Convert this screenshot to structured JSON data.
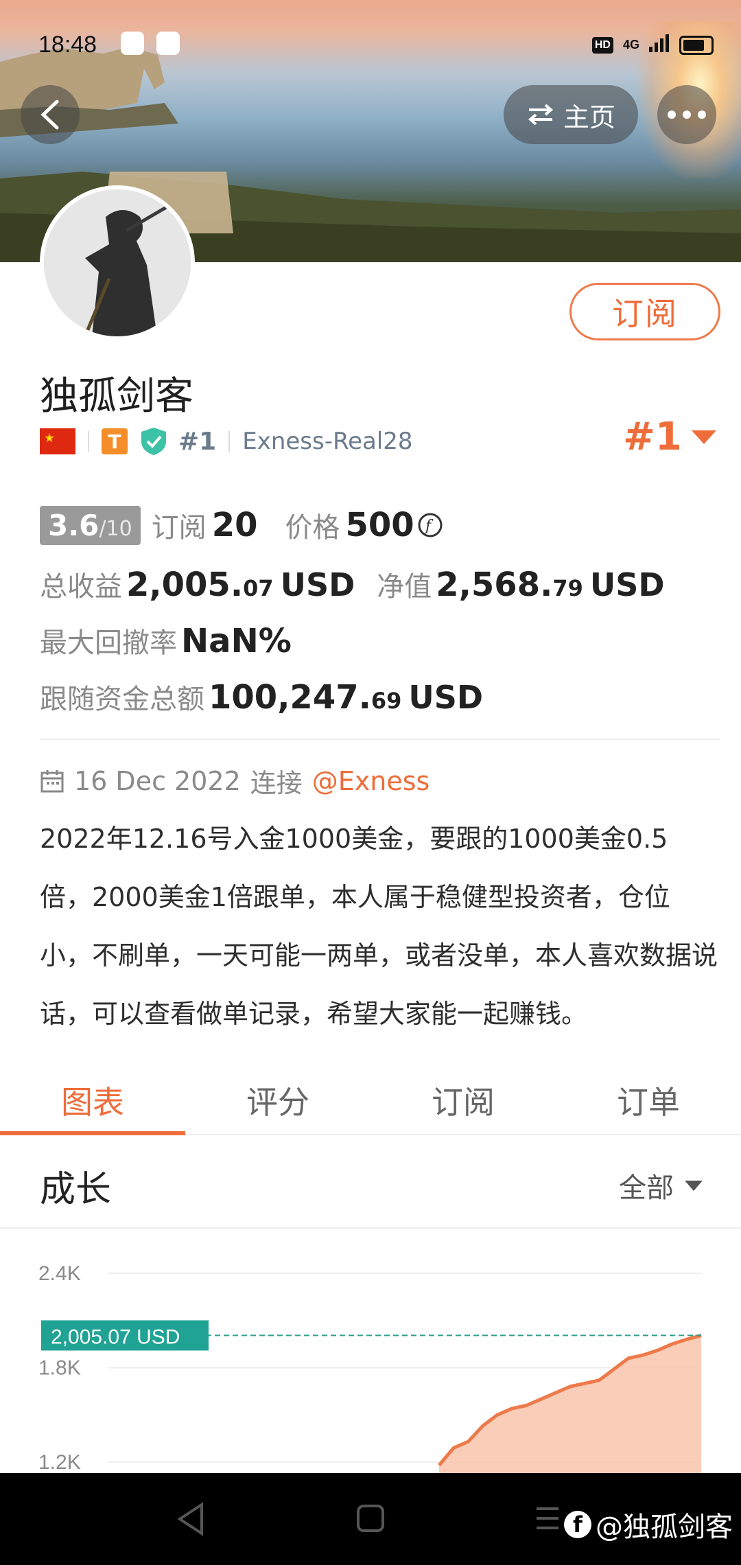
{
  "status_bar": {
    "time": "18:48",
    "network": "4G"
  },
  "header": {
    "home_label": "主页"
  },
  "profile": {
    "subscribe_label": "订阅",
    "name": "独孤剑客",
    "tier_badge": "T",
    "rank_small": "#1",
    "account": "Exness-Real28",
    "rank_big": "#1"
  },
  "stats": {
    "score": "3.6",
    "score_max": "/10",
    "subscribers_label": "订阅",
    "subscribers": "20",
    "price_label": "价格",
    "price": "500",
    "total_profit_label": "总收益",
    "total_profit_int": "2,005.",
    "total_profit_dec": "07",
    "equity_label": "净值",
    "equity_int": "2,568.",
    "equity_dec": "79",
    "currency": "USD",
    "drawdown_label": "最大回撤率",
    "drawdown": "NaN%",
    "follow_label": "跟随资金总额",
    "follow_int": "100,247.",
    "follow_dec": "69"
  },
  "connection": {
    "date": "16 Dec 2022",
    "connect_label": "连接",
    "broker": "@Exness"
  },
  "description": "2022年12.16号入金1000美金，要跟的1000美金0.5倍，2000美金1倍跟单，本人属于稳健型投资者，仓位小，不刷单，一天可能一两单，或者没单，本人喜欢数据说话，可以查看做单记录，希望大家能一起赚钱。",
  "tabs": [
    {
      "label": "图表",
      "active": true
    },
    {
      "label": "评分",
      "active": false
    },
    {
      "label": "订阅",
      "active": false
    },
    {
      "label": "订单",
      "active": false
    }
  ],
  "growth": {
    "title": "成长",
    "filter": "全部"
  },
  "chart_data": {
    "type": "area",
    "y_ticks": [
      "2.4K",
      "1.8K",
      "1.2K"
    ],
    "y_tick_values": [
      2400,
      1800,
      1200
    ],
    "current_label": "2,005.07 USD",
    "current_value": 2005.07,
    "line_color": "#ee7a4a",
    "fill_color": "#f8c4ab",
    "ref_line_color": "#2a9d8f",
    "series_values": [
      1180,
      1290,
      1330,
      1430,
      1500,
      1540,
      1560,
      1600,
      1640,
      1680,
      1700,
      1720,
      1790,
      1860,
      1880,
      1910,
      1950,
      1980,
      2005.07
    ]
  },
  "watermark": "@独孤剑客"
}
